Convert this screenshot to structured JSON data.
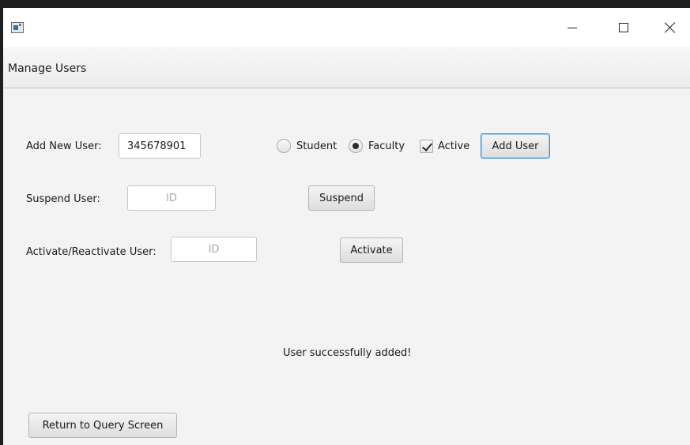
{
  "menubar": {
    "title": "Manage Users"
  },
  "add_user": {
    "label": "Add New User:",
    "id_value": "345678901",
    "role_options": [
      {
        "label": "Student",
        "selected": false
      },
      {
        "label": "Faculty",
        "selected": true
      }
    ],
    "active_label": "Active",
    "active_checked": true,
    "button_label": "Add User"
  },
  "suspend_user": {
    "label": "Suspend User:",
    "id_placeholder": "ID",
    "button_label": "Suspend"
  },
  "activate_user": {
    "label": "Activate/Reactivate User:",
    "id_placeholder": "ID",
    "button_label": "Activate"
  },
  "status_message": "User successfully added!",
  "footer": {
    "return_button_label": "Return to Query Screen"
  },
  "icons": [
    "app-icon",
    "minimize-icon",
    "maximize-icon",
    "close-icon"
  ]
}
